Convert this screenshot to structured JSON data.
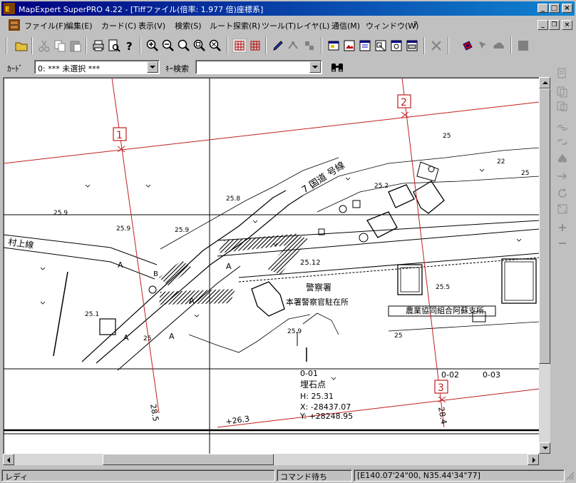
{
  "window": {
    "title": "MapExpert SuperPRO 4.22  - [Tiffファイル(倍率:   1.977 倍)座標系]",
    "minimize": "_",
    "maximize": "□",
    "close": "×"
  },
  "menu": {
    "items": [
      "ファイル(F)",
      "編集(E)",
      "カード(C)",
      "表示(V)",
      "検索(S)",
      "ルート探索(R)",
      "ツール(T)",
      "レイヤ(L)",
      "通信(M)",
      "ウィンドウ(W)",
      "?"
    ],
    "mdi_minimize": "_",
    "mdi_restore": "❐",
    "mdi_close": "×"
  },
  "toolbar": {
    "icons": [
      "open-folder-icon",
      "cut-icon",
      "copy-icon",
      "paste-icon",
      "print-icon",
      "print-preview-icon",
      "help-icon",
      "zoom-in-icon",
      "zoom-out-icon",
      "zoom-fit-icon",
      "zoom-window-icon",
      "zoom-cancel-icon",
      "grid-icon",
      "grid-red-icon",
      "pen-icon",
      "measure-icon",
      "stamp-icon",
      "window-icon",
      "image-icon",
      "layer-icon",
      "map-icon",
      "camera-icon",
      "print2-icon",
      "delete-icon",
      "marker-icon",
      "select-icon",
      "cloud-icon",
      "stop-icon"
    ]
  },
  "searchbar": {
    "card_label": "ｶｰﾄﾞ",
    "card_value": "0: *** 未選択 ***",
    "key_label": "ｷｰ検索",
    "key_value": ""
  },
  "map": {
    "markers": [
      "1",
      "2",
      "3"
    ],
    "road_label": "7 国道 号線",
    "left_label": "村上線",
    "police_1": "警察署",
    "police_2": "本署警察官駐在所",
    "coop": "農業協同組合阿蘇支所",
    "benchmark_id": "0-01",
    "benchmark_title": "埋石点",
    "benchmark_h": "H: 25.31",
    "benchmark_x": "X: -28437.07",
    "benchmark_y": "Y: +28248.95",
    "grid_labels": [
      "0-02",
      "0-03"
    ],
    "elev_bottom": "+26.3",
    "vert_label_1": "28.5",
    "vert_label_2": "28.4",
    "elevations": [
      "25.9",
      "25.8",
      "25.9",
      "25.9",
      "25.1",
      "25",
      "25.2",
      "25.12",
      "25.5",
      "25.9",
      "25",
      "25",
      "22",
      "25"
    ],
    "letters": [
      "A",
      "A",
      "A",
      "A",
      "B",
      "A"
    ]
  },
  "status": {
    "state": "レディ",
    "command": "コマンド待ち",
    "coords": "[E140.07'24\"00, N35.44'34\"77]"
  }
}
